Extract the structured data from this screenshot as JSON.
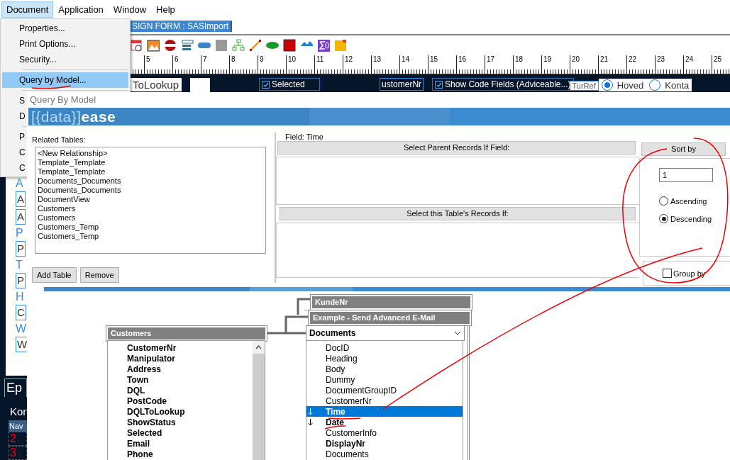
{
  "menubar": [
    {
      "label": "Document",
      "selected": true
    },
    {
      "label": "Application",
      "selected": false
    },
    {
      "label": "Window",
      "selected": false
    },
    {
      "label": "Help",
      "selected": false
    }
  ],
  "menu": [
    {
      "kind": "item",
      "label": "Properties...",
      "selected": false
    },
    {
      "kind": "item",
      "label": "Print Options...",
      "selected": false
    },
    {
      "kind": "item",
      "label": "Security...",
      "selected": false
    },
    {
      "kind": "separator"
    },
    {
      "kind": "item",
      "label": "Query by Model...",
      "selected": true
    },
    {
      "kind": "separator"
    },
    {
      "kind": "item",
      "label": "S",
      "selected": false
    },
    {
      "kind": "item",
      "label": "D",
      "selected": false
    },
    {
      "kind": "separator"
    },
    {
      "kind": "item",
      "label": "P",
      "selected": false
    },
    {
      "kind": "item",
      "label": "C",
      "selected": false
    },
    {
      "kind": "item",
      "label": "C",
      "selected": false
    }
  ],
  "designer": {
    "tab": "SIGN FORM : SASImport",
    "ruler_marks": [
      "5",
      "6",
      "7",
      "8",
      "9",
      "10",
      "11",
      "12",
      "13",
      "14",
      "15",
      "16",
      "17",
      "18",
      "19",
      "20",
      "21",
      "22",
      "23",
      "24",
      "25"
    ],
    "lookup_label": "ToLookup",
    "selected_checkbox": {
      "label": "Selected",
      "checked": true
    },
    "customer_field": "ustomerNr",
    "code_fields_checkbox": {
      "label": "Show Code Fields (Adviceable...)",
      "checked": true
    },
    "turref": "TurRef",
    "radios": [
      {
        "label": "Hoved",
        "selected": true
      },
      {
        "label": "Konta",
        "selected": false
      }
    ],
    "side_items": [
      {
        "kind": "label",
        "text": "A"
      },
      {
        "kind": "field",
        "text": "A"
      },
      {
        "kind": "field",
        "text": "A"
      },
      {
        "kind": "label",
        "text": "P"
      },
      {
        "kind": "field",
        "text": "P"
      },
      {
        "kind": "label",
        "text": "T"
      },
      {
        "kind": "field",
        "text": "P"
      },
      {
        "kind": "label",
        "text": "H"
      },
      {
        "kind": "field",
        "text": "C"
      },
      {
        "kind": "label",
        "text": "W"
      },
      {
        "kind": "field",
        "text": "W"
      }
    ],
    "tab_label": "Ep",
    "section_label": "Kon",
    "grid_header": "Nav",
    "row_numbers": [
      "2",
      "3"
    ]
  },
  "dialog": {
    "title": "Query By Model",
    "logo": "[{data}]**ease**",
    "related_label": "Related Tables:",
    "related_tables": [
      "<New Relationship>",
      "Template_Template",
      "Template_Template",
      "Documents_Documents",
      "Documents_Documents",
      "DocumentView",
      "Customers",
      "Customers",
      "Customers_Temp",
      "Customers_Temp"
    ],
    "buttons": [
      "Add Table",
      "Remove"
    ],
    "field_label": "Field:",
    "field_value": "Time",
    "parent_header": "Select Parent Records If Field:",
    "records_header": "Select this Table's Records If:",
    "sort": {
      "header": "Sort by",
      "order": "1",
      "options": [
        {
          "label": "Ascending",
          "selected": false
        },
        {
          "label": "Descending",
          "selected": true
        }
      ]
    },
    "group_by": {
      "label": "Group by",
      "checked": false
    }
  },
  "diagram": {
    "parent_headers": [
      "KundeNr",
      "Example - Send Advanced E-Mail"
    ],
    "customers": {
      "title": "Customers",
      "fields": [
        {
          "label": "CustomerNr",
          "bold": true
        },
        {
          "label": "Manipulator",
          "bold": true
        },
        {
          "label": "Address",
          "bold": true
        },
        {
          "label": "Town",
          "bold": true
        },
        {
          "label": "DQL",
          "bold": true
        },
        {
          "label": "PostCode",
          "bold": true
        },
        {
          "label": "DQLToLookup",
          "bold": true
        },
        {
          "label": "ShowStatus",
          "bold": true
        },
        {
          "label": "Selected",
          "bold": true
        },
        {
          "label": "Email",
          "bold": true
        },
        {
          "label": "Phone",
          "bold": true
        }
      ]
    },
    "documents": {
      "title": "Documents",
      "fields": [
        {
          "label": "DocID",
          "bold": false,
          "selected": false,
          "sort_descending": false
        },
        {
          "label": "Heading",
          "bold": false,
          "selected": false,
          "sort_descending": false
        },
        {
          "label": "Body",
          "bold": false,
          "selected": false,
          "sort_descending": false
        },
        {
          "label": "Dummy",
          "bold": false,
          "selected": false,
          "sort_descending": false
        },
        {
          "label": "DocumentGroupID",
          "bold": false,
          "selected": false,
          "sort_descending": false
        },
        {
          "label": "CustomerNr",
          "bold": false,
          "selected": false,
          "sort_descending": false
        },
        {
          "label": "Time",
          "bold": true,
          "selected": true,
          "sort_descending": true
        },
        {
          "label": "Date",
          "bold": true,
          "selected": false,
          "sort_descending": true
        },
        {
          "label": "CustomerInfo",
          "bold": false,
          "selected": false,
          "sort_descending": false
        },
        {
          "label": "DisplayNr",
          "bold": true,
          "selected": false,
          "sort_descending": false
        },
        {
          "label": "Documents",
          "bold": false,
          "selected": false,
          "sort_descending": false
        }
      ]
    }
  }
}
